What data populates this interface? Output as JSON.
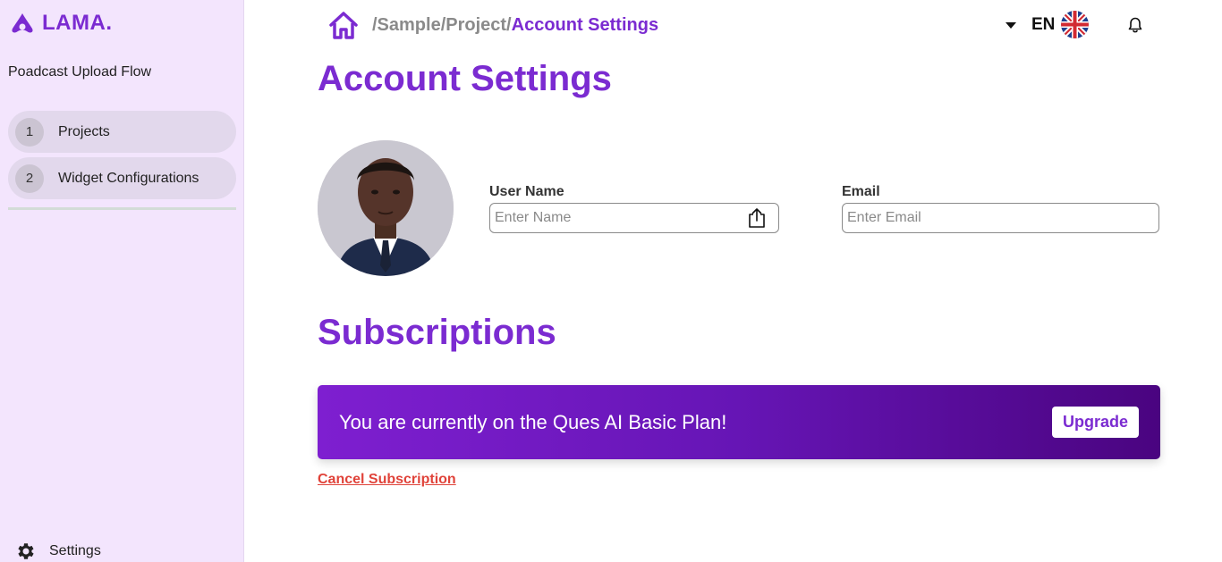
{
  "sidebar": {
    "logo_text": "LAMA.",
    "flow_title": "Poadcast Upload Flow",
    "steps": [
      {
        "num": "1",
        "label": "Projects"
      },
      {
        "num": "2",
        "label": "Widget Configurations"
      }
    ],
    "settings_label": "Settings"
  },
  "header": {
    "breadcrumb_path": "/Sample/Project/",
    "breadcrumb_current": "Account Settings",
    "language": "EN"
  },
  "main": {
    "title": "Account Settings",
    "fields": {
      "username": {
        "label": "User Name",
        "placeholder": "Enter Name",
        "value": ""
      },
      "email": {
        "label": "Email",
        "placeholder": "Enter Email",
        "value": ""
      }
    },
    "subscriptions_title": "Subscriptions",
    "plan_text": "You are currently on the Ques AI Basic Plan!",
    "upgrade_label": "Upgrade",
    "cancel_label": "Cancel Subscription"
  },
  "colors": {
    "accent": "#7b2bd1",
    "sidebar_bg": "#f3e5fd",
    "danger": "#e0433a",
    "banner_start": "#7e1fd0",
    "banner_end": "#4a0480"
  },
  "icons": [
    "lama-logo-icon",
    "home-icon",
    "caret-down-icon",
    "uk-flag-icon",
    "bell-icon",
    "upload-icon",
    "gear-icon"
  ]
}
